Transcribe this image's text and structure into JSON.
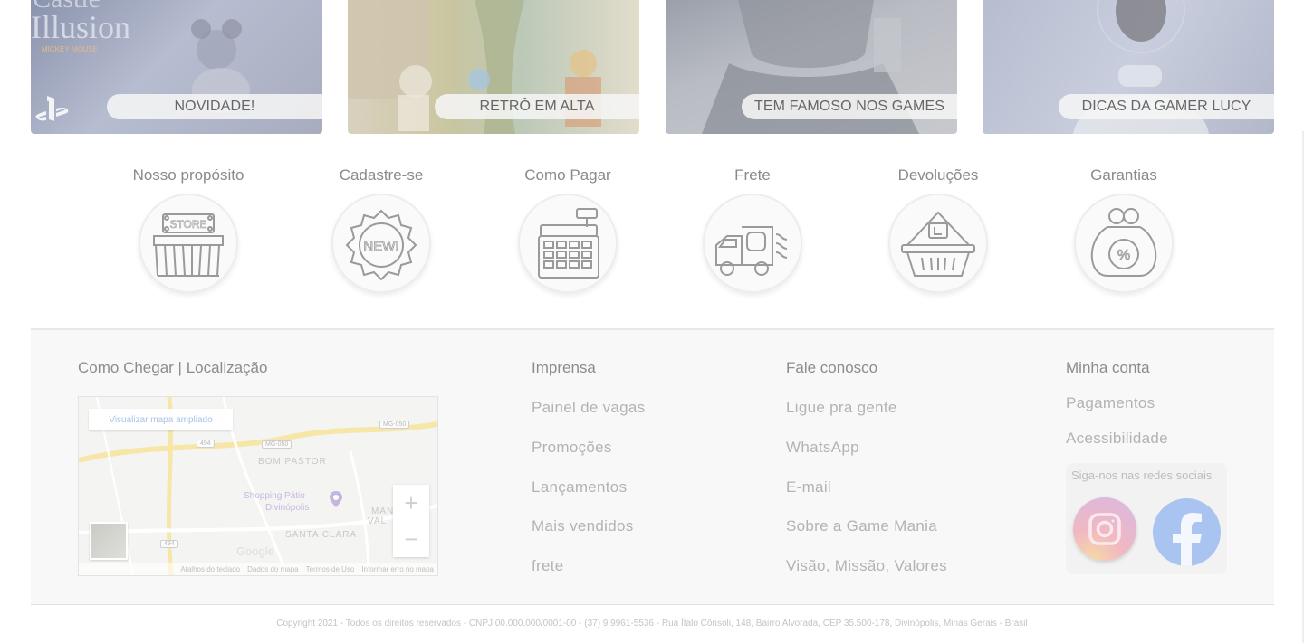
{
  "banners": [
    {
      "label": "NOVIDADE!",
      "logo_text": "Castle of Illusion",
      "logo_sub": "MICKEY MOUSE",
      "icon": "playstation-icon"
    },
    {
      "label": "RETRÔ EM ALTA"
    },
    {
      "label": "TEM FAMOSO NOS GAMES"
    },
    {
      "label": "DICAS DA GAMER LUCY"
    }
  ],
  "features": [
    {
      "title": "Nosso propósito",
      "icon": "store-icon",
      "icon_text": "STORE"
    },
    {
      "title": "Cadastre-se",
      "icon": "new-badge-icon",
      "icon_text": "NEW!"
    },
    {
      "title": "Como Pagar",
      "icon": "cash-register-icon"
    },
    {
      "title": "Frete",
      "icon": "delivery-truck-icon"
    },
    {
      "title": "Devoluções",
      "icon": "shopping-basket-icon"
    },
    {
      "title": "Garantias",
      "icon": "discount-purse-icon",
      "icon_text": "%"
    }
  ],
  "footer": {
    "location": {
      "title": "Como Chegar | Localização",
      "map": {
        "enlarge_button": "Visualizar mapa ampliado",
        "labels": [
          "BOM PASTOR",
          "Shopping Pátio",
          "Divinópolis",
          "SANTA CLARA",
          "MAN",
          "VALI"
        ],
        "road_shields": [
          "494",
          "MG-050",
          "MG-050",
          "494"
        ],
        "zoom_in": "+",
        "zoom_out": "−",
        "google": "Google",
        "footer_links": [
          "Atalhos do teclado",
          "Dados do mapa",
          "Termos de Uso",
          "Informar erro no mapa"
        ]
      }
    },
    "columns": [
      {
        "title": "Imprensa",
        "links": [
          "Painel de vagas",
          "Promoções",
          "Lançamentos",
          "Mais vendidos",
          "frete"
        ]
      },
      {
        "title": "Fale conosco",
        "links": [
          "Ligue pra gente",
          "WhatsApp",
          "E-mail",
          "Sobre a Game Mania",
          "Visão, Missão, Valores"
        ]
      },
      {
        "title": "Minha conta",
        "links": [
          "Pagamentos",
          "Acessibilidade"
        ]
      }
    ],
    "social": {
      "title": "Siga-nos nas redes sociais",
      "items": [
        "instagram-icon",
        "facebook-icon"
      ]
    }
  },
  "copyright": "Copyright 2021 - Todos os direitos reservados - CNPJ 00.000.000/0001-00 - (37) 9.9961-5536 - Rua Ítalo Cônsoli, 148, Bairro Alvorada, CEP 35.500-178, Divinópolis, Minas Gerais - Brasil",
  "colors": {
    "link": "#b3b3b3",
    "title": "#8c8c8c",
    "facebook": "#a9c4f1",
    "map_link": "#a9c2ea"
  }
}
